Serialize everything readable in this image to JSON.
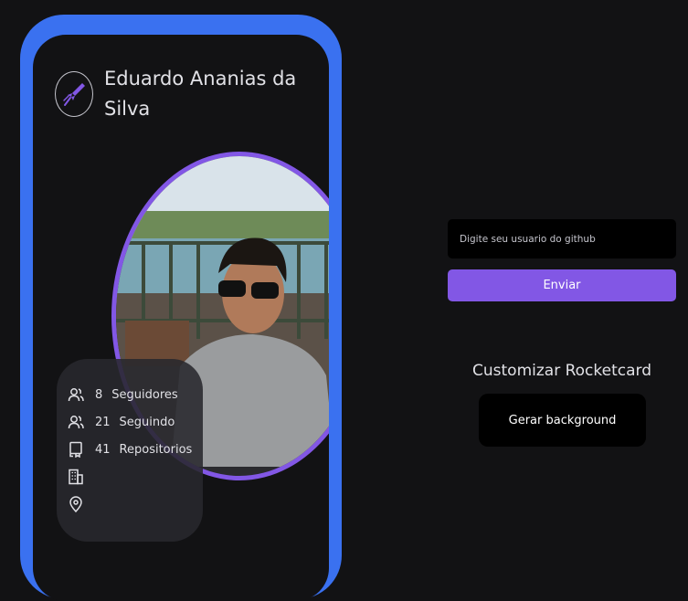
{
  "card": {
    "name": "Eduardo Ananias da Silva",
    "stats": [
      {
        "icon": "users-icon",
        "count": "8",
        "label": "Seguidores"
      },
      {
        "icon": "users-icon",
        "count": "21",
        "label": "Seguindo"
      },
      {
        "icon": "book-icon",
        "count": "41",
        "label": "Repositorios"
      },
      {
        "icon": "building-icon",
        "count": "",
        "label": ""
      },
      {
        "icon": "map-pin-icon",
        "count": "",
        "label": ""
      }
    ]
  },
  "form": {
    "username_placeholder": "Digite seu usuario do github",
    "username_value": "",
    "submit_label": "Enviar"
  },
  "customize": {
    "title": "Customizar Rocketcard",
    "background_button_label": "Gerar background"
  },
  "colors": {
    "page_background": "#121214",
    "card_border": "#3a71f0",
    "accent_purple": "#8257e5",
    "input_background": "#000000"
  }
}
